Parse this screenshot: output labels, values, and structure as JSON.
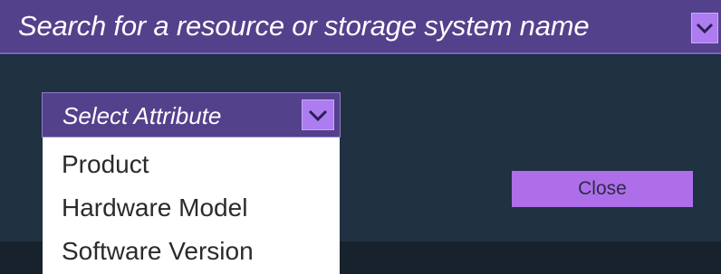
{
  "search": {
    "placeholder": "Search for a resource or storage system name",
    "chevron_icon": "chevron-down-icon"
  },
  "attribute_select": {
    "selected_label": "Select Attribute",
    "chevron_icon": "chevron-down-icon",
    "options": [
      "Product",
      "Hardware Model",
      "Software Version"
    ]
  },
  "actions": {
    "close_label": "Close"
  },
  "colors": {
    "header_purple": "#54418c",
    "chevron_lilac": "#ad7cf0",
    "panel_dark": "#203142",
    "button_purple": "#ae6eea"
  }
}
